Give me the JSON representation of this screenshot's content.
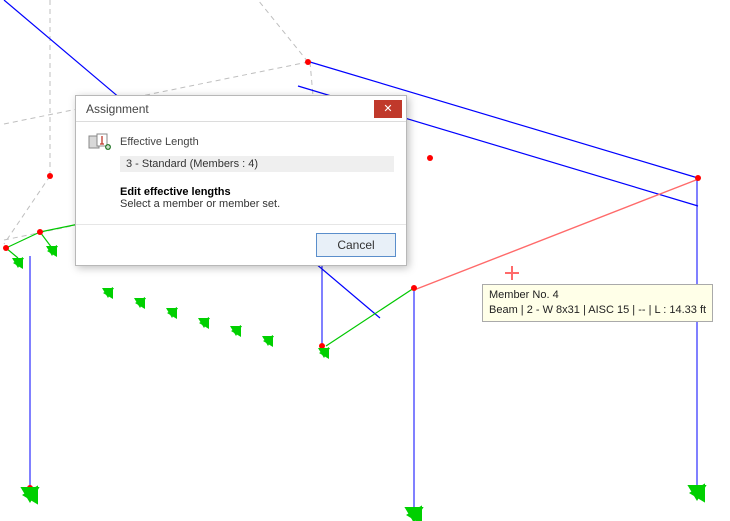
{
  "dialog": {
    "title": "Assignment",
    "close_glyph": "✕",
    "section_label": "Effective Length",
    "entry": "3 - Standard (Members : 4)",
    "instruction_head": "Edit effective lengths",
    "instruction_sub": "Select a member or member set.",
    "cancel_label": "Cancel"
  },
  "tooltip": {
    "line1": "Member No. 4",
    "line2": "Beam | 2 - W 8x31 | AISC 15 | -- | L : 14.33 ft"
  },
  "colors": {
    "beam": "#0000ff",
    "beam_selected": "#ff6a6a",
    "line_green": "#00c800",
    "dashed": "#bfbfbf",
    "node": "#ff0000",
    "support": "#00d000",
    "dialog_close": "#c0392b",
    "button_border": "#5a8ecb"
  }
}
